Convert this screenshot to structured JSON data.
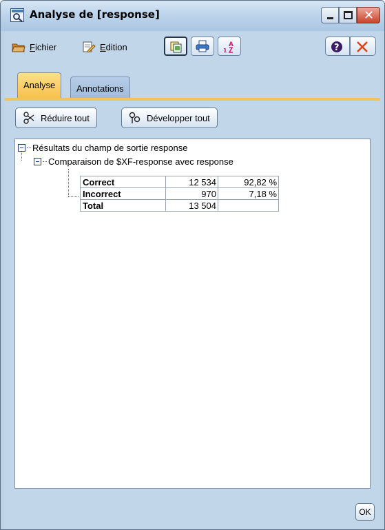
{
  "window": {
    "title": "Analyse de [response]"
  },
  "menu": {
    "file_label": "Fichier",
    "file_mnemonic": "F",
    "file_rest": "ichier",
    "edit_mnemonic": "E",
    "edit_rest": "dition"
  },
  "tabs": [
    {
      "label": "Analyse",
      "active": true
    },
    {
      "label": "Annotations",
      "active": false
    }
  ],
  "actions": {
    "collapse_label": "Réduire tout",
    "expand_label": "Développer tout"
  },
  "tree": {
    "root_label": "Résultats du champ de sortie response",
    "child_label": "Comparaison de $XF-response avec response"
  },
  "results": [
    {
      "label": "Correct",
      "count": "12 534",
      "percent": "92,82 %"
    },
    {
      "label": "Incorrect",
      "count": "970",
      "percent": "7,18 %"
    },
    {
      "label": "Total",
      "count": "13 504",
      "percent": ""
    }
  ],
  "ok_label": "OK",
  "colors": {
    "active_tab": "#f6c04a",
    "close_button": "#c8432c",
    "window_bg": "#c2d6ea"
  },
  "icons": {
    "title": "magnifier-window-icon",
    "file": "folder-icon",
    "edit": "edit-page-icon",
    "copy": "copy-icon",
    "print": "printer-icon",
    "sort": "sort-az-icon",
    "help": "help-icon",
    "close": "close-x-icon",
    "collapse": "collapse-icon",
    "expand": "expand-icon"
  }
}
